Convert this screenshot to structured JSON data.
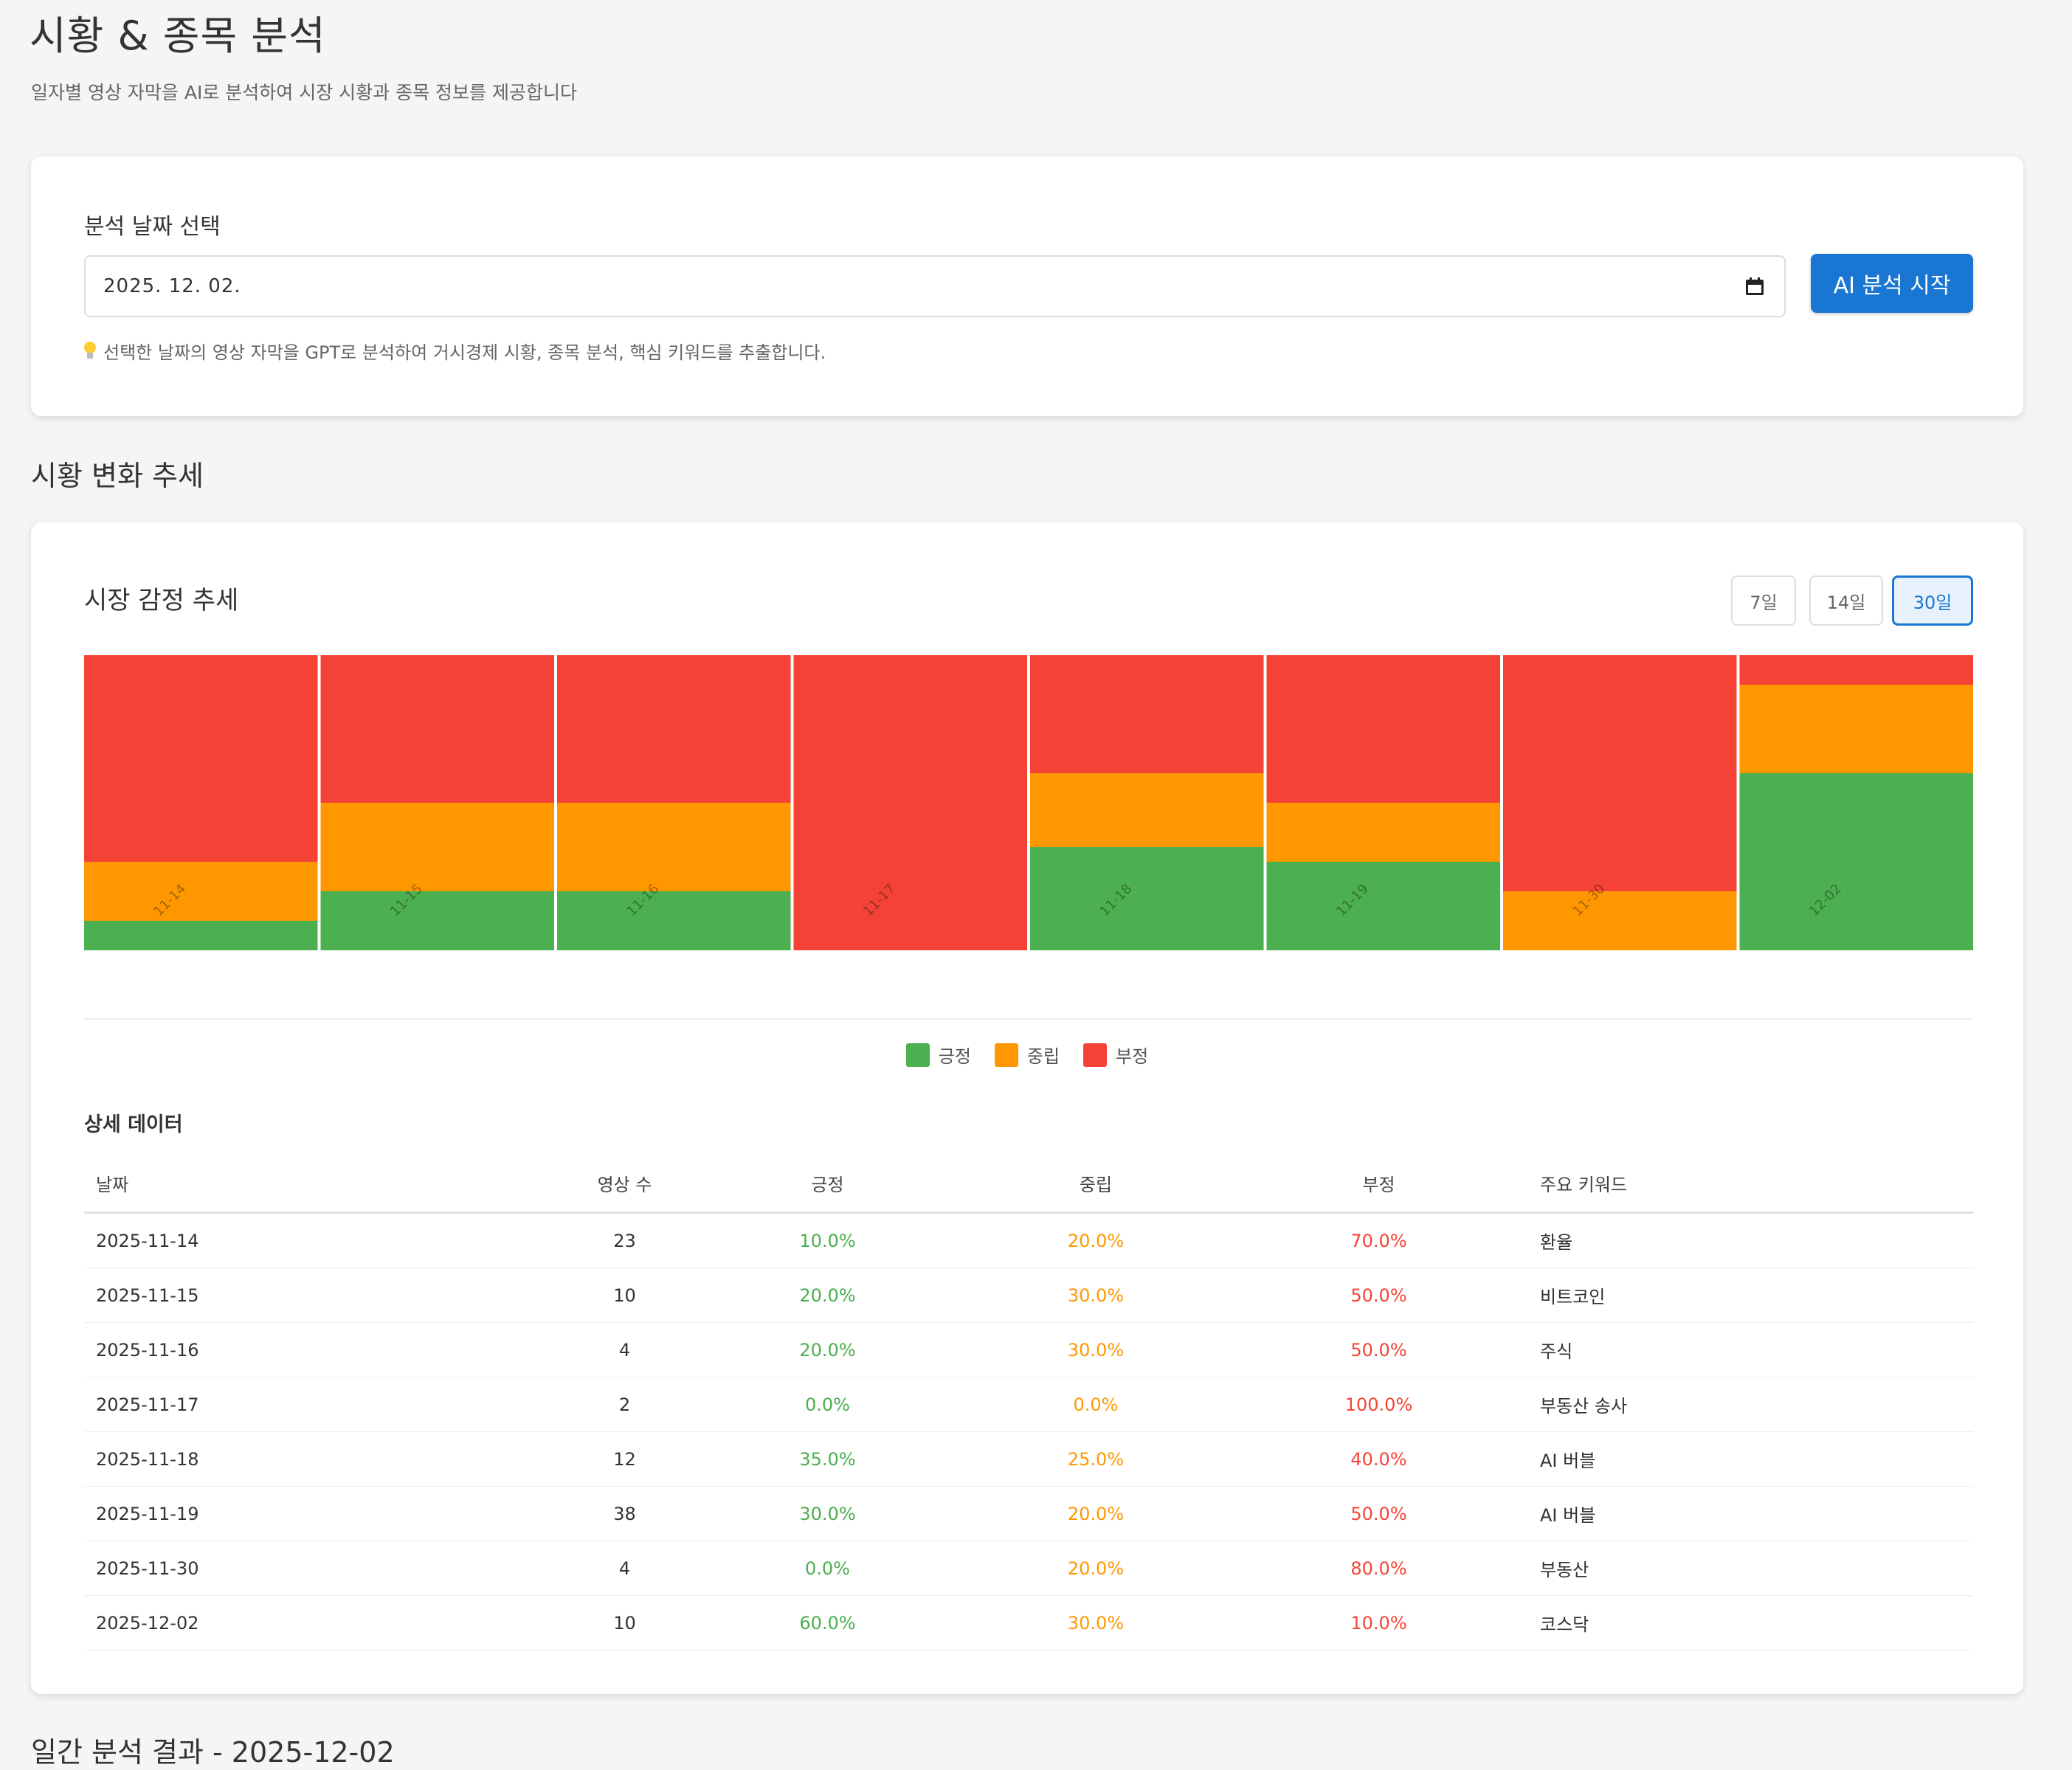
{
  "header": {
    "title": "시황 & 종목 분석",
    "subtitle": "일자별 영상 자막을 AI로 분석하여 시장 시황과 종목 정보를 제공합니다"
  },
  "date_picker": {
    "label": "분석 날짜 선택",
    "value": "2025. 12. 02.",
    "button_label": "AI 분석 시작",
    "hint": "선택한 날짜의 영상 자막을 GPT로 분석하여 거시경제 시황, 종목 분석, 핵심 키워드를 추출합니다.",
    "hint_icon": "lightbulb-icon"
  },
  "trend_section": {
    "title": "시황 변화 추세",
    "chart_title": "시장 감정 추세",
    "ranges": [
      "7일",
      "14일",
      "30일"
    ],
    "active_range": "30일"
  },
  "colors": {
    "positive": "#4caf50",
    "neutral": "#ff9800",
    "negative": "#f44336",
    "accent": "#1976d2"
  },
  "chart_data": {
    "type": "bar",
    "stacked": true,
    "categories": [
      "11-14",
      "11-15",
      "11-16",
      "11-17",
      "11-18",
      "11-19",
      "11-30",
      "12-02"
    ],
    "series": [
      {
        "name": "긍정",
        "color": "#4caf50",
        "values": [
          10,
          20,
          20,
          0,
          35,
          30,
          0,
          60
        ]
      },
      {
        "name": "중립",
        "color": "#ff9800",
        "values": [
          20,
          30,
          30,
          0,
          25,
          20,
          20,
          30
        ]
      },
      {
        "name": "부정",
        "color": "#f44336",
        "values": [
          70,
          50,
          50,
          100,
          40,
          50,
          80,
          10
        ]
      }
    ],
    "ylim": [
      0,
      100
    ],
    "legend": "bottom-center"
  },
  "detail": {
    "title": "상세 데이터",
    "columns": [
      "날짜",
      "영상 수",
      "긍정",
      "중립",
      "부정",
      "주요 키워드"
    ],
    "rows": [
      {
        "date": "2025-11-14",
        "videos": "23",
        "pos": "10.0%",
        "neu": "20.0%",
        "neg": "70.0%",
        "keyword": "환율"
      },
      {
        "date": "2025-11-15",
        "videos": "10",
        "pos": "20.0%",
        "neu": "30.0%",
        "neg": "50.0%",
        "keyword": "비트코인"
      },
      {
        "date": "2025-11-16",
        "videos": "4",
        "pos": "20.0%",
        "neu": "30.0%",
        "neg": "50.0%",
        "keyword": "주식"
      },
      {
        "date": "2025-11-17",
        "videos": "2",
        "pos": "0.0%",
        "neu": "0.0%",
        "neg": "100.0%",
        "keyword": "부동산 송사"
      },
      {
        "date": "2025-11-18",
        "videos": "12",
        "pos": "35.0%",
        "neu": "25.0%",
        "neg": "40.0%",
        "keyword": "AI 버블"
      },
      {
        "date": "2025-11-19",
        "videos": "38",
        "pos": "30.0%",
        "neu": "20.0%",
        "neg": "50.0%",
        "keyword": "AI 버블"
      },
      {
        "date": "2025-11-30",
        "videos": "4",
        "pos": "0.0%",
        "neu": "20.0%",
        "neg": "80.0%",
        "keyword": "부동산"
      },
      {
        "date": "2025-12-02",
        "videos": "10",
        "pos": "60.0%",
        "neu": "30.0%",
        "neg": "10.0%",
        "keyword": "코스닥"
      }
    ]
  },
  "next_section": {
    "title": "일간 분석 결과 - 2025-12-02"
  }
}
